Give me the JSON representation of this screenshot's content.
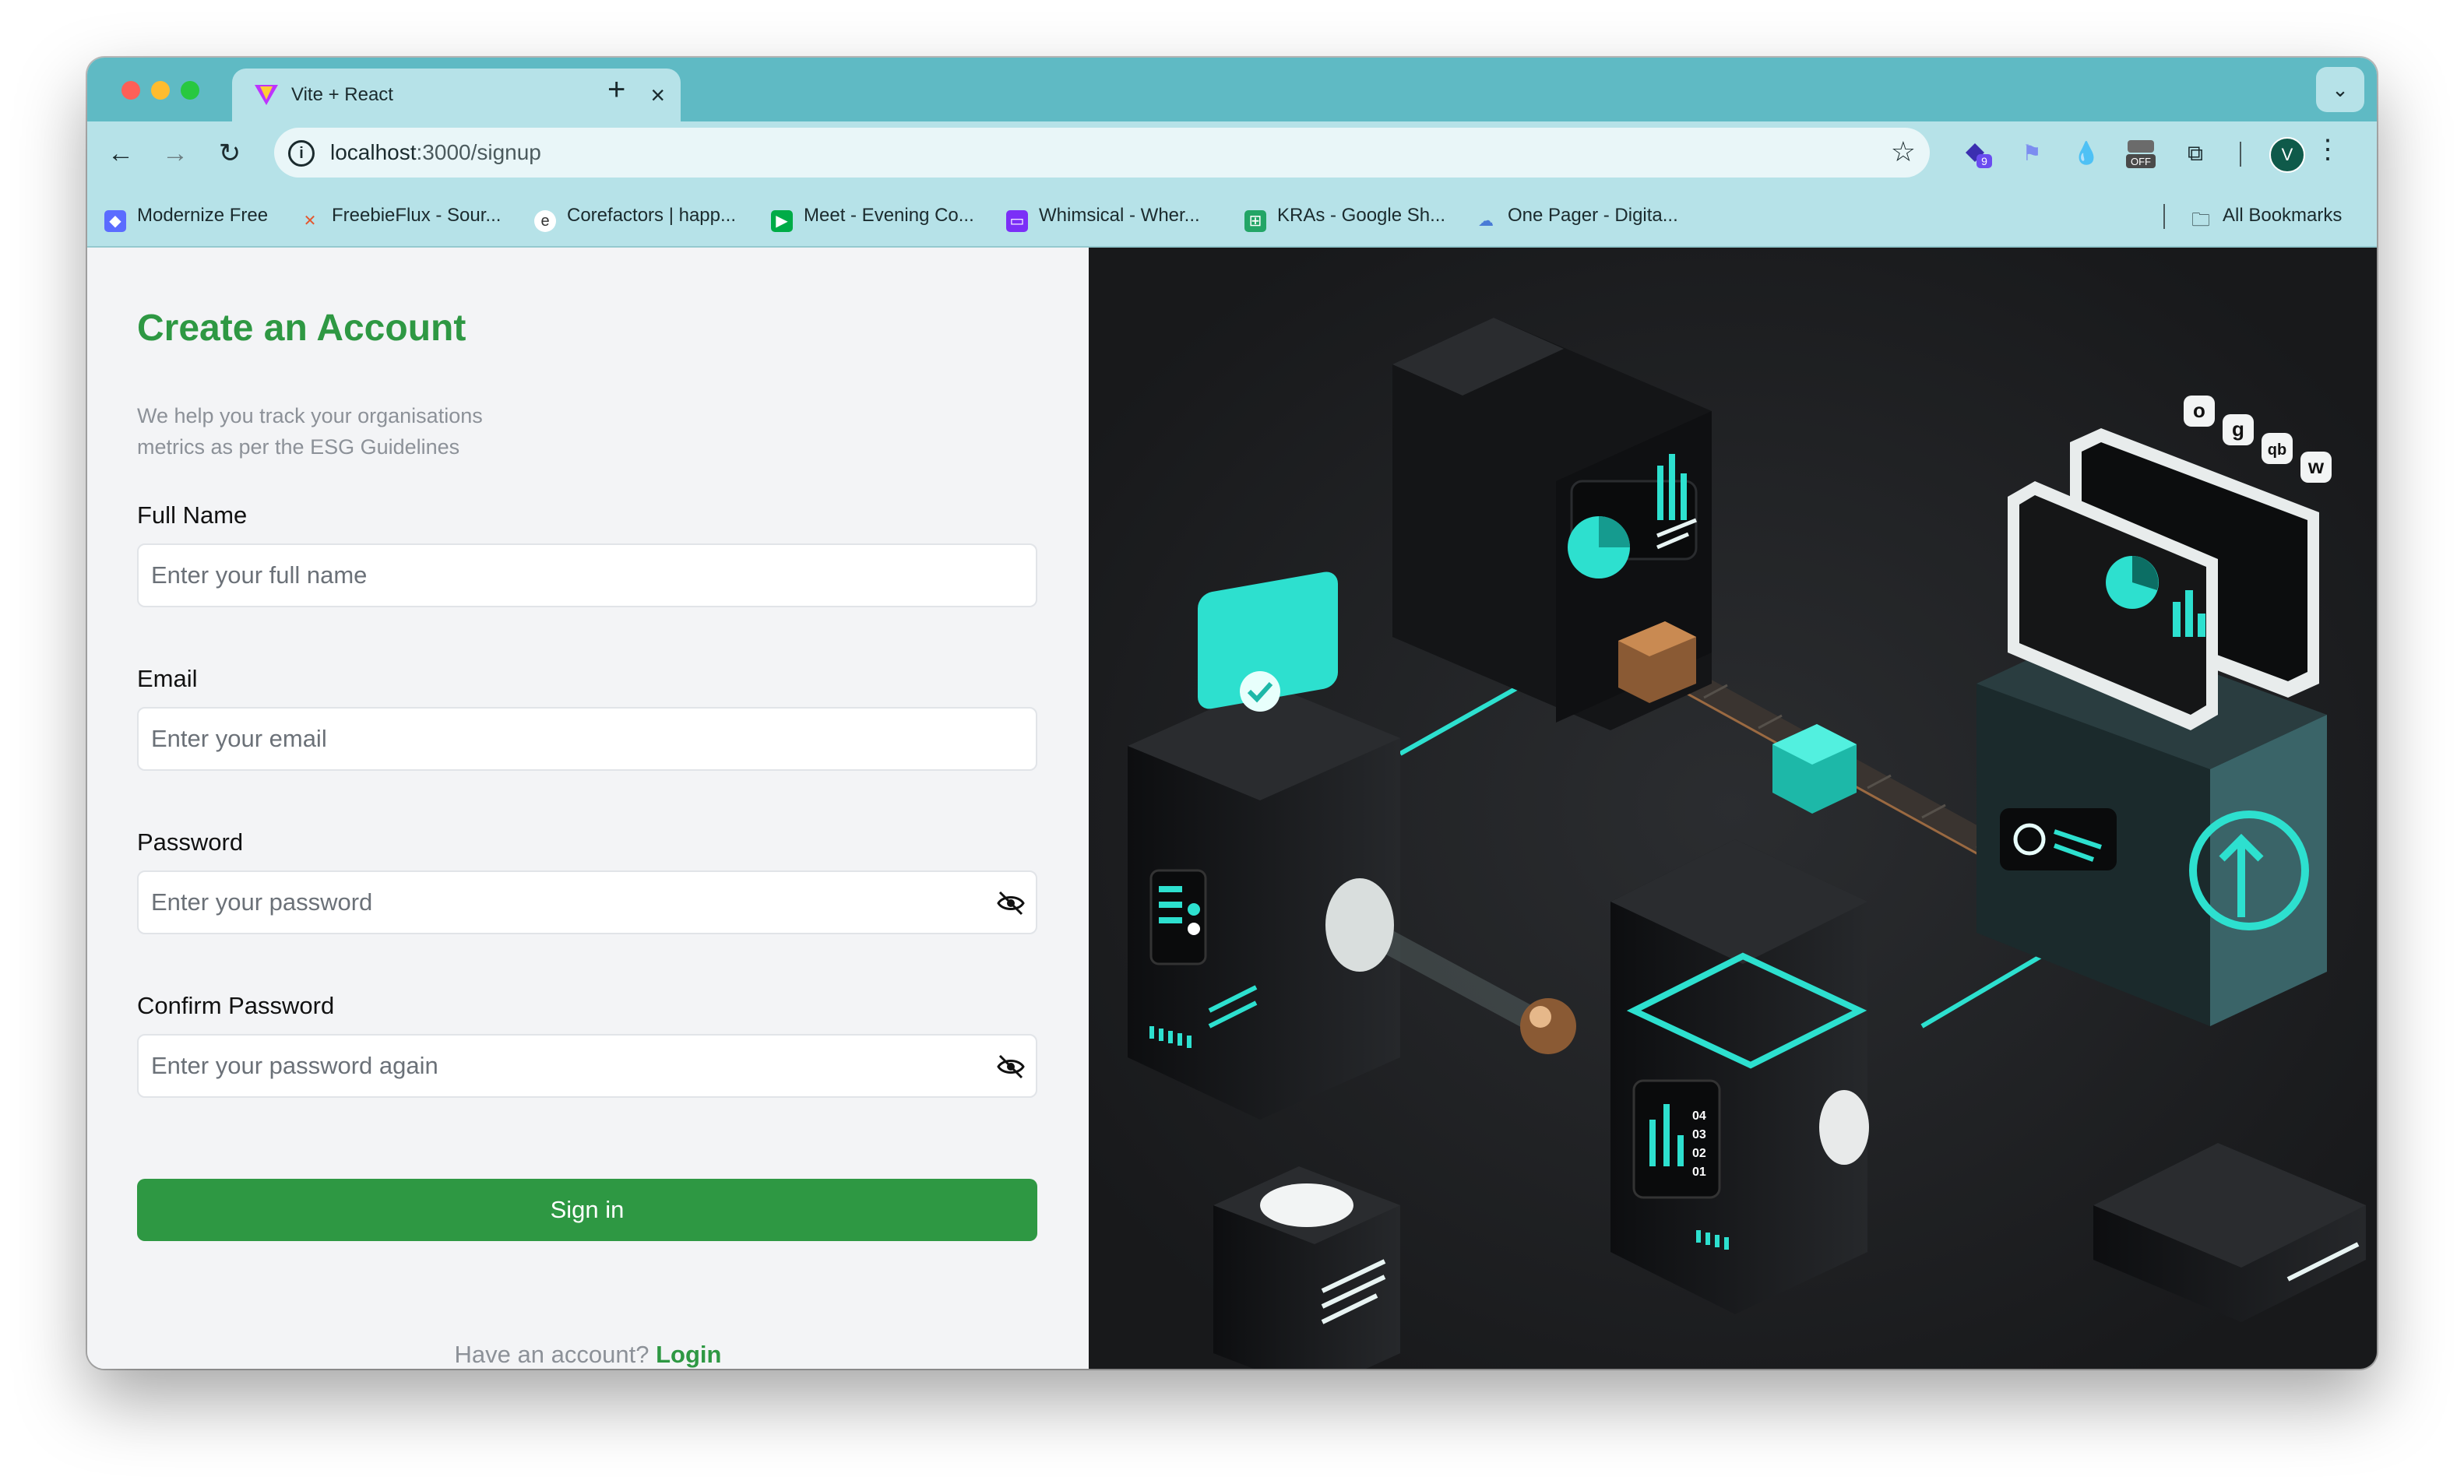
{
  "browser": {
    "tab_title": "Vite + React",
    "tab_close": "×",
    "new_tab": "+",
    "tab_menu": "⌄",
    "url_host": "localhost",
    "url_path": ":3000/signup",
    "extension_badge": "9",
    "extension_toggle": "OFF",
    "profile_initial": "V",
    "menu_glyph": "⋮",
    "bookmarks": [
      {
        "label": "Modernize Free",
        "icon": "modernize-icon",
        "color": "#5b6cff"
      },
      {
        "label": "FreebieFlux - Sour...",
        "icon": "freebieflux-icon",
        "color": "#e4572e"
      },
      {
        "label": "Corefactors | happ...",
        "icon": "corefactors-icon",
        "color": "#ffffff"
      },
      {
        "label": "Meet - Evening Co...",
        "icon": "google-meet-icon",
        "color": "#00ac47"
      },
      {
        "label": "Whimsical - Wher...",
        "icon": "whimsical-icon",
        "color": "#7b2ff7"
      },
      {
        "label": "KRAs - Google Sh...",
        "icon": "google-sheets-icon",
        "color": "#23a566"
      },
      {
        "label": "One Pager - Digita...",
        "icon": "onedrive-icon",
        "color": "#4a7bd6"
      }
    ],
    "all_bookmarks": "All Bookmarks"
  },
  "form": {
    "title": "Create an Account",
    "subtitle": "We help you track your organisations metrics as per the ESG Guidelines",
    "fields": [
      {
        "label": "Full Name",
        "placeholder": "Enter your full name",
        "value": ""
      },
      {
        "label": "Email",
        "placeholder": "Enter your email",
        "value": ""
      },
      {
        "label": "Password",
        "placeholder": "Enter your password",
        "value": ""
      },
      {
        "label": "Confirm Password",
        "placeholder": "Enter your password again",
        "value": ""
      }
    ],
    "submit_label": "Sign in",
    "footer_text": "Have an account?",
    "login_link": "Login"
  },
  "illustration": {
    "chart_ticks": [
      "04",
      "03",
      "02",
      "01"
    ],
    "logo_letters": [
      "o",
      "g",
      "qb",
      "w"
    ],
    "accent": "#2de0cf"
  },
  "colors": {
    "brand_green": "#2e9843",
    "browser_teal": "#5fbac4",
    "illustration_bg": "#1e1f21"
  }
}
